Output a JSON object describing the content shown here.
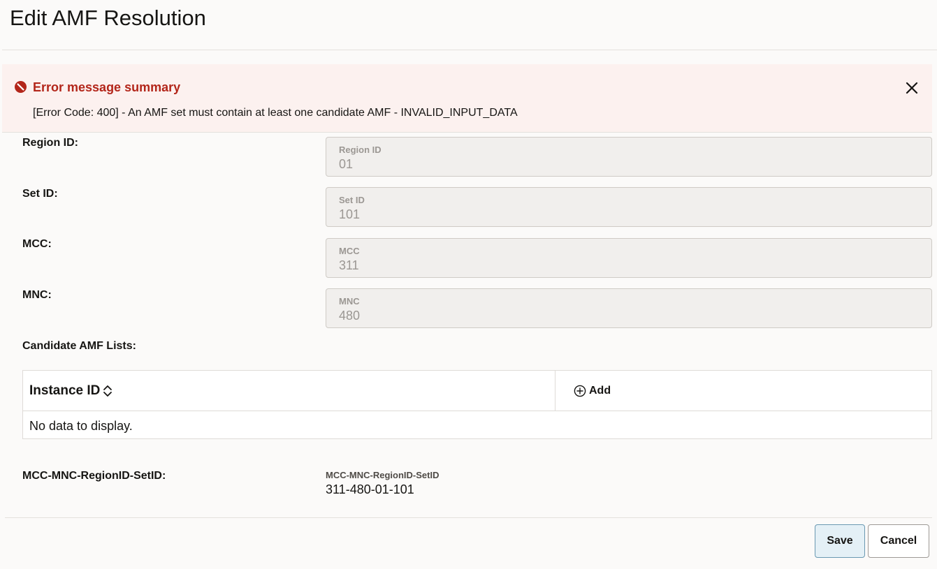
{
  "page": {
    "title": "Edit AMF Resolution"
  },
  "error": {
    "title": "Error message summary",
    "message": "[Error Code: 400] - An AMF set must contain at least one candidate AMF - INVALID_INPUT_DATA",
    "icon": "error-circle-icon",
    "color": "#b3261a"
  },
  "form": {
    "region": {
      "row_label": "Region ID:",
      "field_label": "Region ID",
      "value": "01"
    },
    "set": {
      "row_label": "Set ID:",
      "field_label": "Set ID",
      "value": "101"
    },
    "mcc": {
      "row_label": "MCC:",
      "field_label": "MCC",
      "value": "311"
    },
    "mnc": {
      "row_label": "MNC:",
      "field_label": "MNC",
      "value": "480"
    },
    "candidates": {
      "row_label": "Candidate AMF Lists:",
      "columns": [
        "Instance ID"
      ],
      "add_label": "Add",
      "empty_text": "No data to display.",
      "rows": []
    },
    "combo": {
      "row_label": "MCC-MNC-RegionID-SetID:",
      "field_label": "MCC-MNC-RegionID-SetID",
      "value": "311-480-01-101"
    }
  },
  "footer": {
    "save_label": "Save",
    "cancel_label": "Cancel"
  }
}
